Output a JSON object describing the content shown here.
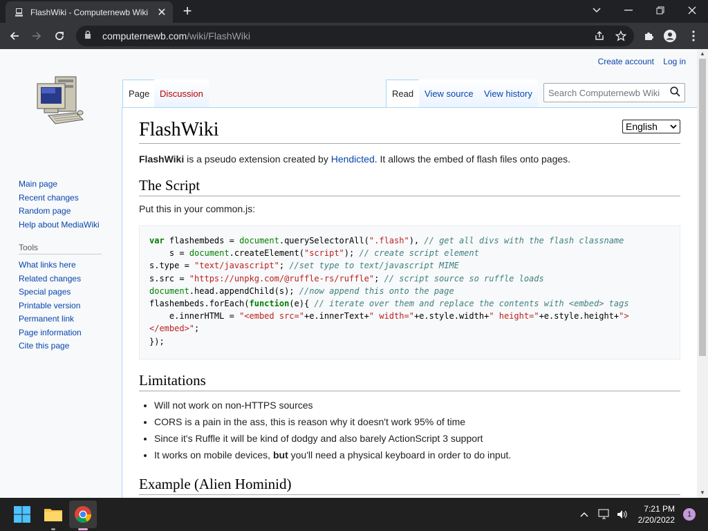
{
  "tab": {
    "title": "FlashWiki - Computernewb Wiki",
    "close": "✕"
  },
  "window": {
    "new_tab": "+"
  },
  "address": {
    "host": "computernewb.com",
    "path": "/wiki/FlashWiki"
  },
  "personal": {
    "create_account": "Create account",
    "log_in": "Log in"
  },
  "nav": {
    "main": [
      "Main page",
      "Recent changes",
      "Random page",
      "Help about MediaWiki"
    ],
    "tools_heading": "Tools",
    "tools": [
      "What links here",
      "Related changes",
      "Special pages",
      "Printable version",
      "Permanent link",
      "Page information",
      "Cite this page"
    ]
  },
  "page_tabs": {
    "page": "Page",
    "discussion": "Discussion",
    "read": "Read",
    "view_source": "View source",
    "view_history": "View history"
  },
  "search": {
    "placeholder": "Search Computernewb Wiki"
  },
  "language": {
    "selected": "English"
  },
  "article": {
    "title": "FlashWiki",
    "intro_bold": "FlashWiki",
    "intro_mid": " is a pseudo extension created by ",
    "intro_link": "Hendicted",
    "intro_end": ". It allows the embed of flash files onto pages.",
    "script_heading": "The Script",
    "script_text": "Put this in your common.js:",
    "limitations_heading": "Limitations",
    "limitations": [
      "Will not work on non-HTTPS sources",
      "CORS is a pain in the ass, this is reason why it doesn't work 95% of time",
      "Since it's Ruffle it will be kind of dodgy and also barely ActionScript 3 support"
    ],
    "limit4_pre": "It works on mobile devices, ",
    "limit4_bold": "but",
    "limit4_post": " you'll need a physical keyboard in order to do input.",
    "next_heading": "Example (Alien Hominid)"
  },
  "taskbar": {
    "time": "7:21 PM",
    "date": "2/20/2022",
    "notifications": "1"
  },
  "colors": {
    "link": "#0645ad",
    "chrome_dark": "#202124",
    "chrome_toolbar": "#35363a"
  }
}
